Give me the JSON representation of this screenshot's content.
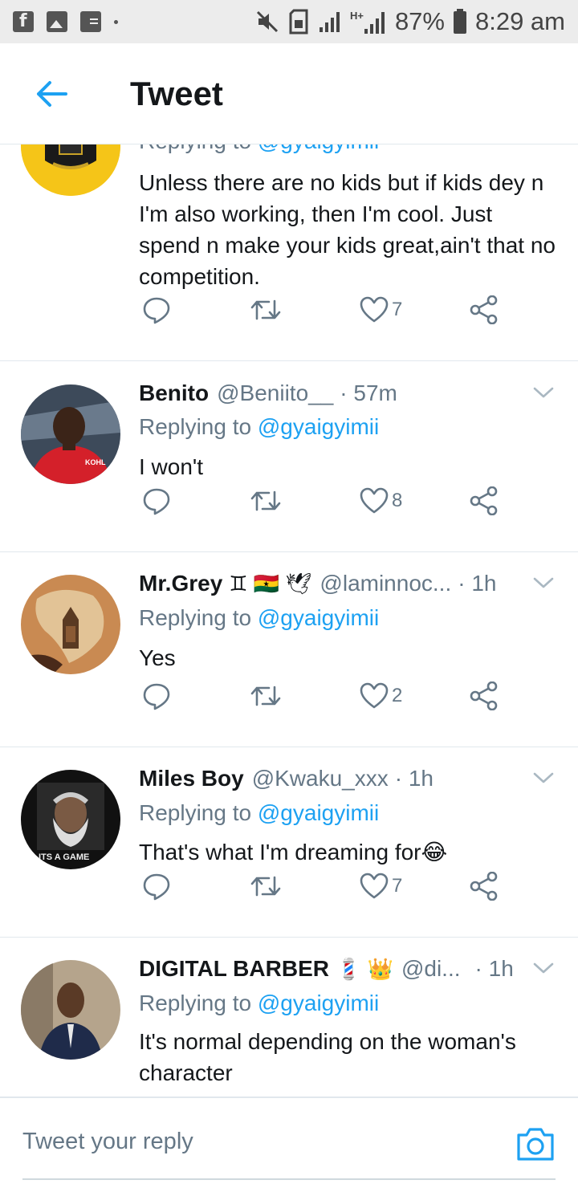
{
  "status_bar": {
    "battery": "87%",
    "time": "8:29 am",
    "left_icons": [
      "facebook-icon",
      "gallery-icon",
      "id-card-icon"
    ],
    "right_icons": [
      "mute-icon",
      "sim-icon",
      "signal-icon",
      "hplus-signal-icon",
      "battery-icon"
    ]
  },
  "header": {
    "title": "Tweet",
    "back_icon": "arrow-left-icon"
  },
  "colors": {
    "accent": "#1da1f2",
    "text": "#14171a",
    "muted": "#657786",
    "divider": "#e1e8ed"
  },
  "tweets": [
    {
      "name": "",
      "handle": "",
      "time": "",
      "replying_label": "Replying to",
      "replying_to": "@gyaigyimii",
      "text": "Unless there are no kids but if kids dey n I'm also working, then I'm cool. Just spend n make your kids great,ain't that no competition.",
      "likes": "7"
    },
    {
      "name": "Benito",
      "handle": "@Beniito__",
      "time": "· 57m",
      "replying_label": "Replying to",
      "replying_to": "@gyaigyimii",
      "text": "I won't",
      "likes": "8"
    },
    {
      "name": "Mr.Grey",
      "name_emoji": "♊ 🇬🇭 🕊",
      "handle": "@laminnoc...",
      "time": "· 1h",
      "replying_label": "Replying to",
      "replying_to": "@gyaigyimii",
      "text": "Yes",
      "likes": "2"
    },
    {
      "name": "Miles Boy",
      "handle": "@Kwaku_xxx",
      "time": "· 1h",
      "replying_label": "Replying to",
      "replying_to": "@gyaigyimii",
      "text": "That's what I'm dreaming for😂",
      "likes": "7"
    },
    {
      "name": "DIGITAL BARBER",
      "name_emoji": "💈 👑",
      "handle": "@di...",
      "time": "· 1h",
      "replying_label": "Replying to",
      "replying_to": "@gyaigyimii",
      "text": "It's normal depending on the woman's character",
      "likes": ""
    }
  ],
  "avatar_texts": {
    "miles": "ITS A GAME"
  },
  "reply_bar": {
    "placeholder": "Tweet your reply",
    "camera_icon": "camera-icon"
  }
}
